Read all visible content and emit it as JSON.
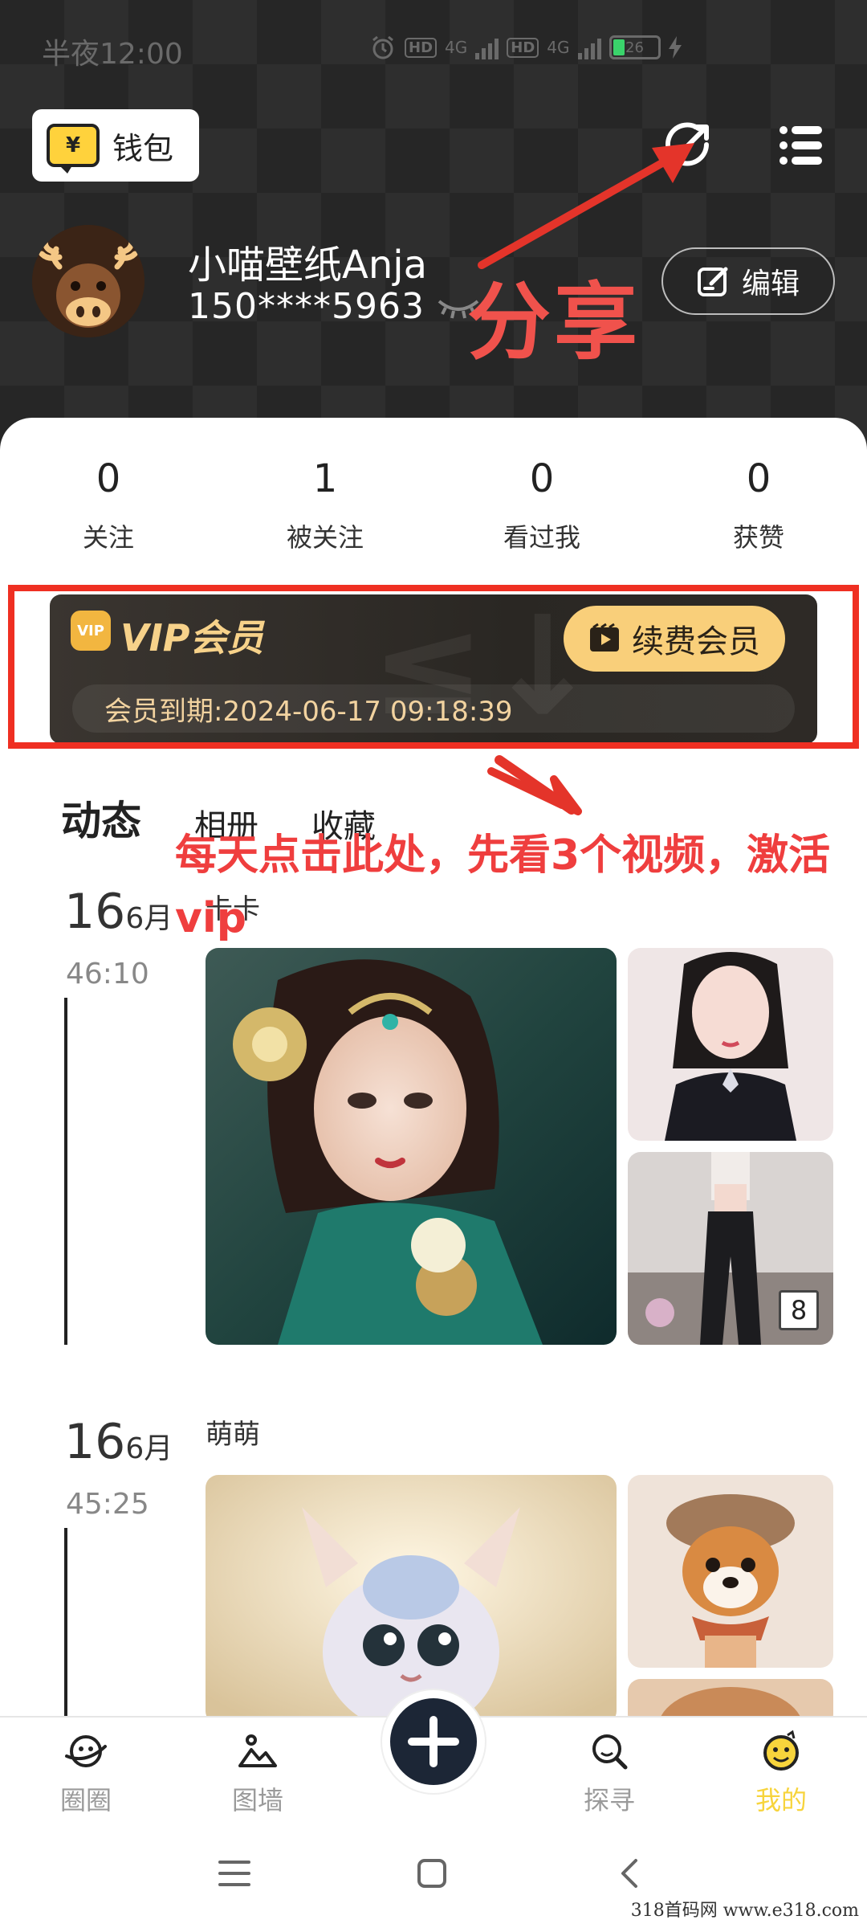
{
  "status_bar": {
    "time": "半夜12:00",
    "network_a": "4G",
    "network_b": "4G",
    "hd_a": "HD",
    "hd_b": "HD",
    "battery": "26",
    "battery_color": "#3ad36b"
  },
  "header": {
    "wallet_label": "钱包",
    "wallet_symbol": "¥",
    "share_icon": "share-icon",
    "menu_icon": "menu-icon"
  },
  "profile": {
    "username": "小喵壁纸Anja",
    "phone": "150****5963",
    "edit_label": "编辑"
  },
  "annotations": {
    "share_text": "分享",
    "vip_text": "每天点击此处，先看3个视频，激活vip",
    "color": "#ef3e3e"
  },
  "stats": [
    {
      "value": "0",
      "label": "关注"
    },
    {
      "value": "1",
      "label": "被关注"
    },
    {
      "value": "0",
      "label": "看过我"
    },
    {
      "value": "0",
      "label": "获赞"
    }
  ],
  "vip": {
    "badge": "VIP",
    "title": "VIP会员",
    "renew_label": "续费会员",
    "expiry": "会员到期:2024-06-17 09:18:39",
    "accent": "#f9cf7a"
  },
  "tabs": [
    {
      "label": "动态",
      "active": true
    },
    {
      "label": "相册",
      "active": false
    },
    {
      "label": "收藏",
      "active": false
    }
  ],
  "posts": [
    {
      "day": "16",
      "month": "6月",
      "time": "46:10",
      "author": "卡卡",
      "image_count": "8"
    },
    {
      "day": "16",
      "month": "6月",
      "time": "45:25",
      "author": "萌萌"
    }
  ],
  "bottom_nav": [
    {
      "label": "圈圈",
      "icon": "planet-icon"
    },
    {
      "label": "图墙",
      "icon": "picture-icon"
    },
    {
      "label": "探寻",
      "icon": "search-icon"
    },
    {
      "label": "我的",
      "icon": "smiley-icon",
      "active": true
    }
  ],
  "watermark": "318首码网  www.e318.com"
}
